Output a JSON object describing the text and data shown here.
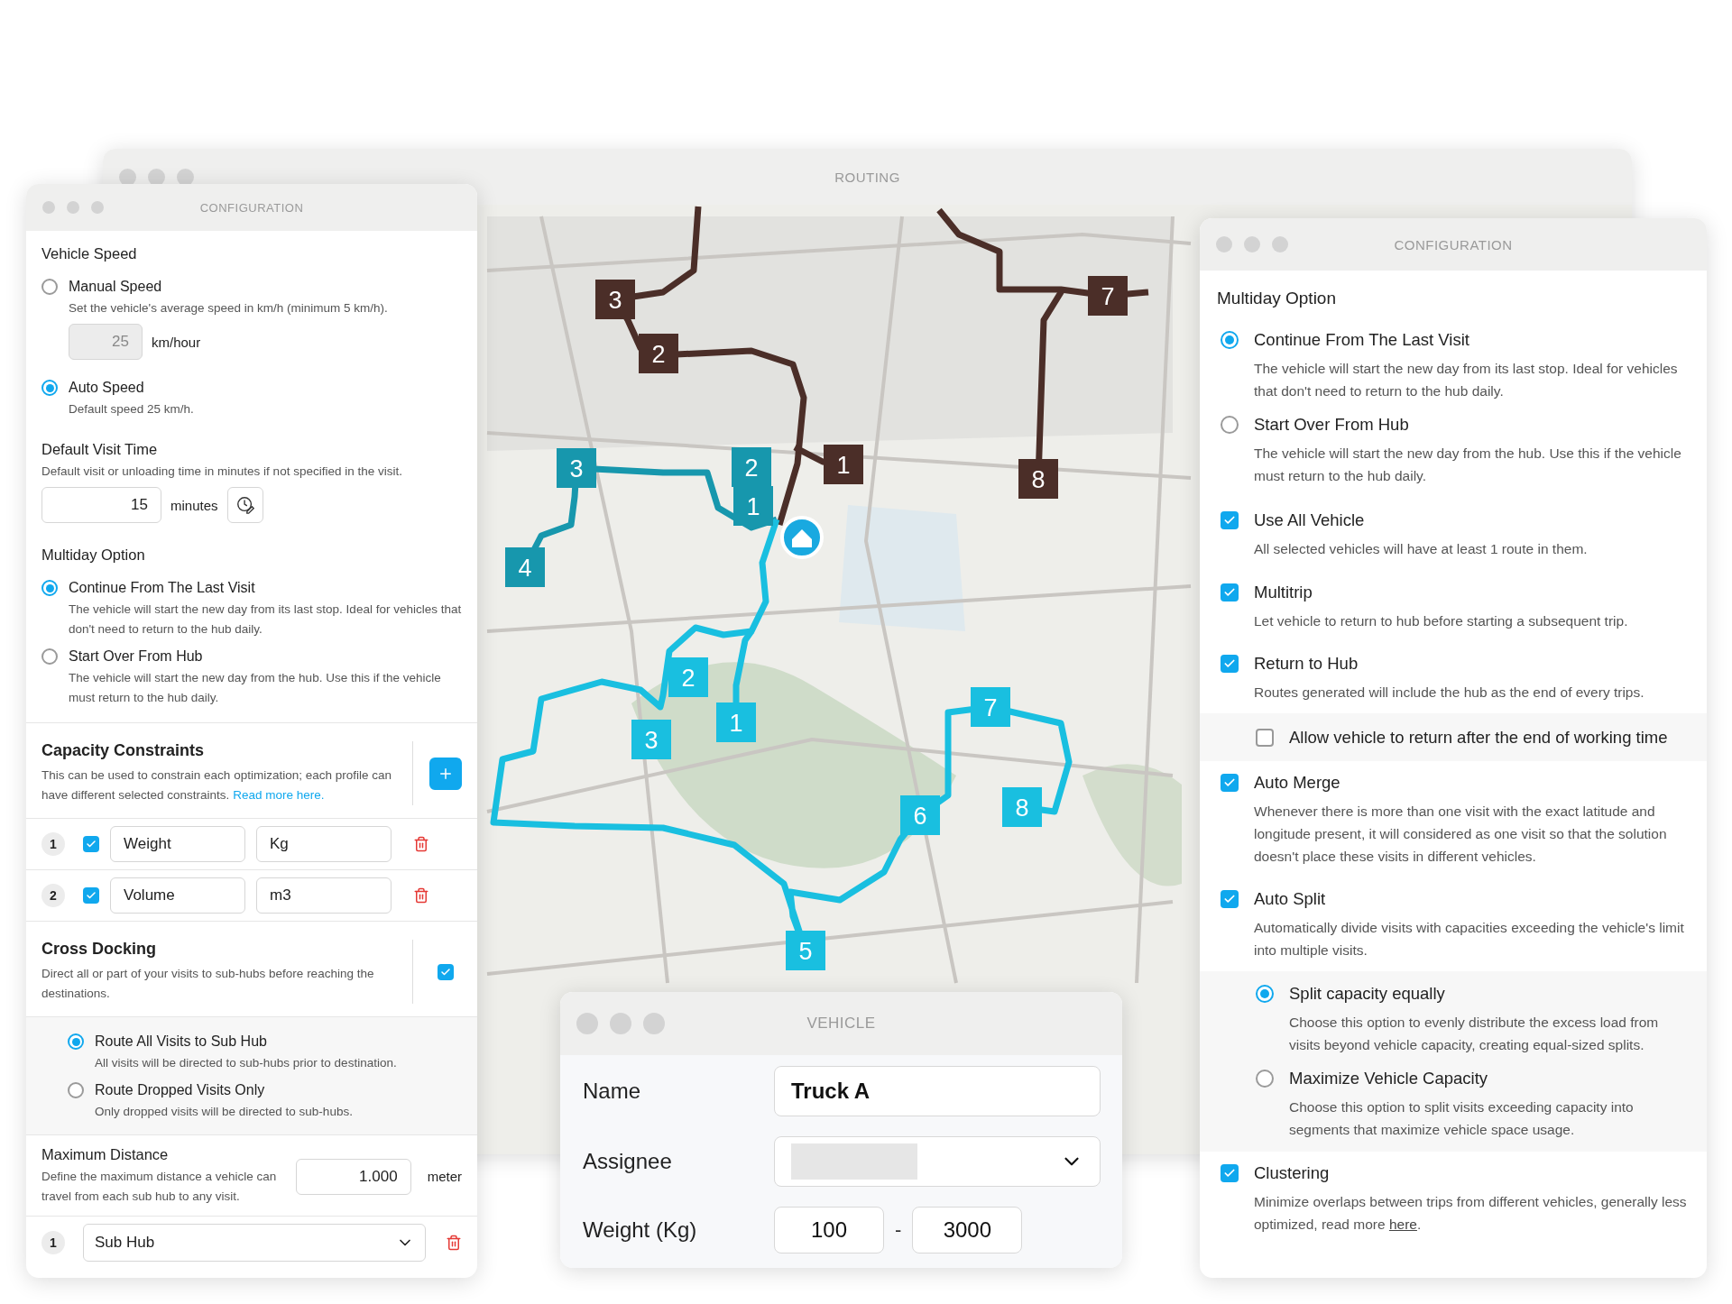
{
  "routing_window": {
    "title": "ROUTING",
    "routes": [
      {
        "color": "#4b2e28",
        "stops": [
          "3",
          "2",
          "1"
        ]
      },
      {
        "color": "#4b2e28",
        "stops": [
          "7",
          "8"
        ]
      },
      {
        "color": "#1797ad",
        "stops": [
          "3",
          "2",
          "1",
          "4"
        ]
      },
      {
        "color": "#19bfe0",
        "stops": [
          "2",
          "1",
          "3",
          "5",
          "6",
          "7",
          "8"
        ]
      }
    ]
  },
  "left_config": {
    "title": "CONFIGURATION",
    "vehicle_speed": {
      "heading": "Vehicle Speed",
      "options": [
        {
          "label": "Manual Speed",
          "description": "Set the vehicle's average speed in km/h (minimum 5 km/h).",
          "selected": false,
          "input": {
            "value": "25",
            "unit": "km/hour",
            "disabled": true
          }
        },
        {
          "label": "Auto Speed",
          "description": "Default speed 25 km/h.",
          "selected": true
        }
      ]
    },
    "visit_time": {
      "heading": "Default Visit Time",
      "description": "Default visit or unloading time in minutes if not specified in the visit.",
      "value": "15",
      "unit": "minutes"
    },
    "multiday": {
      "heading": "Multiday Option",
      "options": [
        {
          "label": "Continue From The Last Visit",
          "description": "The vehicle will start the new day from its last stop. Ideal for vehicles that don't need to return to the hub daily.",
          "selected": true
        },
        {
          "label": "Start Over From Hub",
          "description": "The vehicle will start the new day from the hub. Use this if the vehicle must return to the hub daily.",
          "selected": false
        }
      ]
    },
    "capacity": {
      "heading": "Capacity Constraints",
      "description": "This can be used to constrain each optimization; each profile can have different selected constraints.",
      "link": "Read more here.",
      "rows": [
        {
          "number": "1",
          "checked": true,
          "name": "Weight",
          "unit": "Kg"
        },
        {
          "number": "2",
          "checked": true,
          "name": "Volume",
          "unit": "m3"
        }
      ]
    },
    "cross_docking": {
      "heading": "Cross Docking",
      "description": "Direct all or part of your visits to sub-hubs before reaching the destinations.",
      "checked": true,
      "options": [
        {
          "label": "Route All Visits to Sub Hub",
          "description": "All visits will be directed to sub-hubs prior to destination.",
          "selected": true
        },
        {
          "label": "Route Dropped Visits Only",
          "description": "Only dropped visits will be directed to sub-hubs.",
          "selected": false
        }
      ]
    },
    "max_distance": {
      "heading": "Maximum Distance",
      "description": "Define the maximum distance a vehicle can travel from each sub hub to any visit.",
      "value": "1.000",
      "unit": "meter"
    },
    "sub_hubs": [
      {
        "number": "1",
        "value": "Sub Hub"
      }
    ]
  },
  "right_config": {
    "title": "CONFIGURATION",
    "heading": "Multiday Option",
    "options": [
      {
        "label": "Continue From The Last Visit",
        "description": "The vehicle will start the new day from its last stop. Ideal for vehicles that don't need to return to the hub daily.",
        "selected": true
      },
      {
        "label": "Start Over From Hub",
        "description": "The vehicle will start the new day from the hub. Use this if the vehicle must return to the hub daily.",
        "selected": false
      }
    ],
    "settings": [
      {
        "label": "Use All Vehicle",
        "description": "All selected vehicles will have at least 1 route in them.",
        "checked": true
      },
      {
        "label": "Multitrip",
        "description": "Let vehicle to return to hub before starting a subsequent trip.",
        "checked": true
      },
      {
        "label": "Return to Hub",
        "description": "Routes generated will include the hub as the end of every trips.",
        "checked": true,
        "suboptions": [
          {
            "kind": "checkbox",
            "label": "Allow vehicle to return after the end of working time",
            "checked": false
          }
        ]
      },
      {
        "label": "Auto Merge",
        "description": "Whenever there is more than one visit with the exact latitude and longitude present, it will considered as one visit so that the solution doesn't place these visits in different vehicles.",
        "checked": true
      },
      {
        "label": "Auto Split",
        "description": "Automatically divide visits with capacities exceeding the vehicle's limit into multiple visits.",
        "checked": true,
        "suboptions": [
          {
            "kind": "radio",
            "label": "Split capacity equally",
            "description": "Choose this option to evenly distribute the excess load from visits beyond vehicle capacity, creating equal-sized splits.",
            "selected": true
          },
          {
            "kind": "radio",
            "label": "Maximize Vehicle Capacity",
            "description": "Choose this option to split visits exceeding capacity into segments that maximize vehicle space usage.",
            "selected": false
          }
        ]
      },
      {
        "label": "Clustering",
        "description": "Minimize overlaps between trips from different vehicles, generally less optimized, read more ",
        "link": "here",
        "after_link": ".",
        "checked": true
      }
    ]
  },
  "vehicle_window": {
    "title": "VEHICLE",
    "fields": [
      {
        "kind": "text",
        "label": "Name",
        "value": "Truck A"
      },
      {
        "kind": "select",
        "label": "Assignee"
      },
      {
        "kind": "range",
        "label": "Weight (Kg)",
        "min": "100",
        "separator": "-",
        "max": "3000"
      }
    ]
  }
}
